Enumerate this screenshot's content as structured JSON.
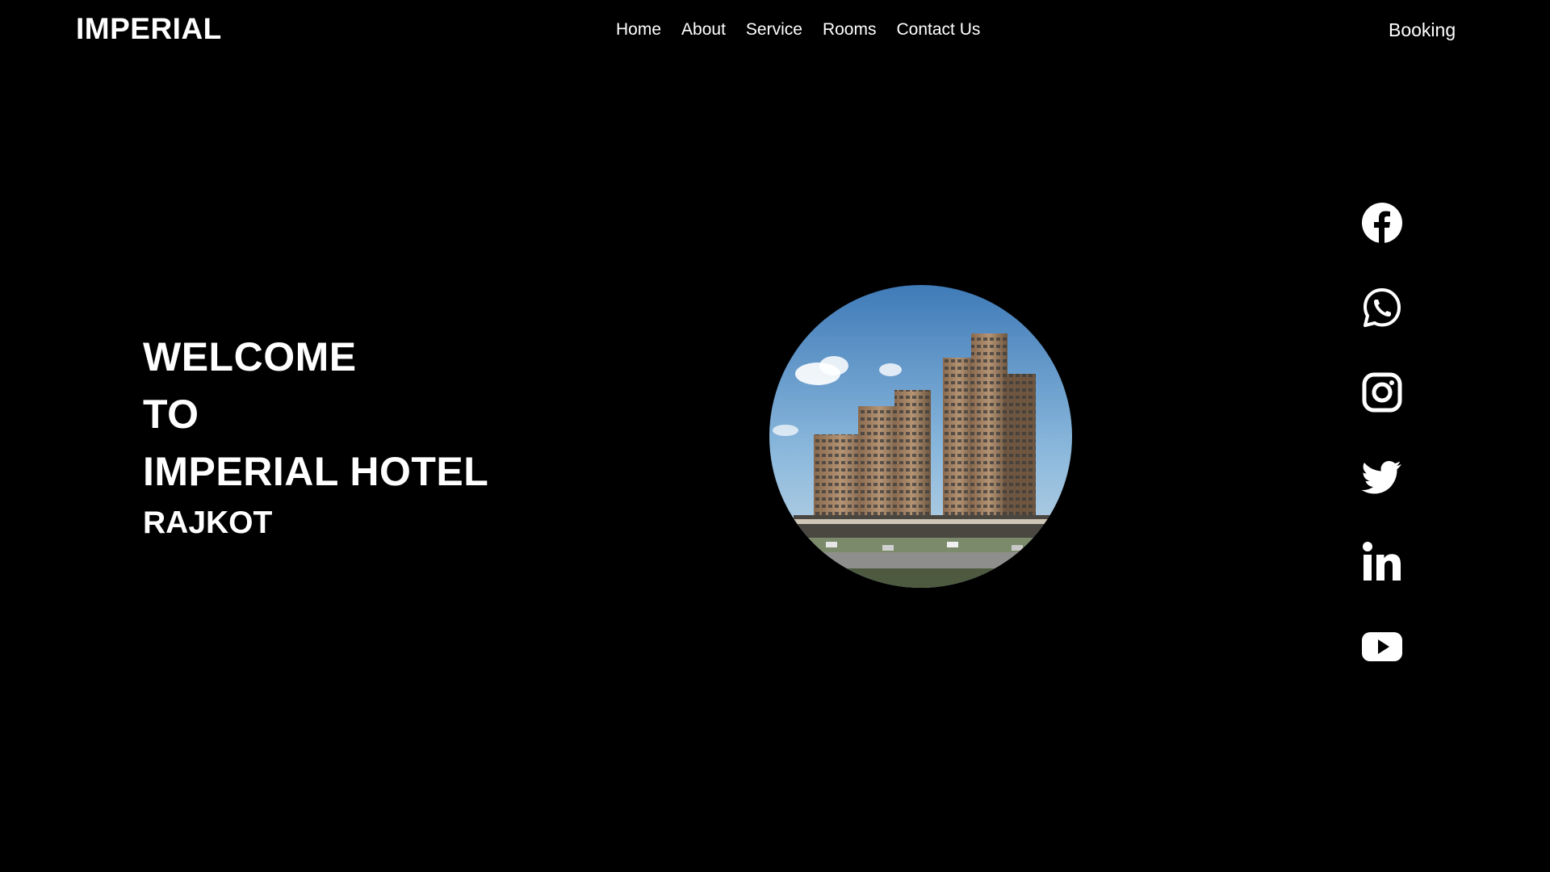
{
  "header": {
    "logo": "IMPERIAL",
    "nav": [
      {
        "label": "Home"
      },
      {
        "label": "About"
      },
      {
        "label": "Service"
      },
      {
        "label": "Rooms"
      },
      {
        "label": "Contact Us"
      }
    ],
    "booking_label": "Booking"
  },
  "hero": {
    "lines": [
      "WELCOME",
      "TO",
      "IMPERIAL HOTEL"
    ],
    "subline": "RAJKOT",
    "image": "hotel-building-photo"
  },
  "social": [
    {
      "icon": "facebook-icon"
    },
    {
      "icon": "whatsapp-icon"
    },
    {
      "icon": "instagram-icon"
    },
    {
      "icon": "twitter-icon"
    },
    {
      "icon": "linkedin-icon"
    },
    {
      "icon": "youtube-icon"
    }
  ],
  "colors": {
    "background": "#000000",
    "text": "#ffffff"
  }
}
